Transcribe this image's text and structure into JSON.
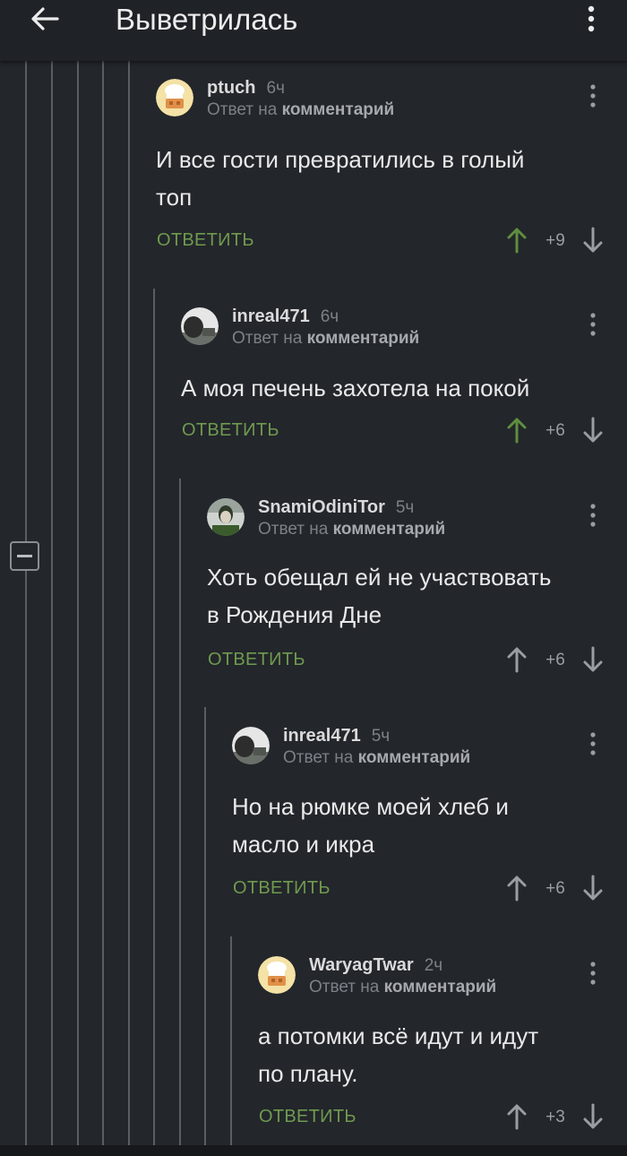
{
  "appbar": {
    "title": "Выветрилась"
  },
  "comments": [
    {
      "username": "ptuch",
      "time": "6ч",
      "reply_prefix": "Ответ на",
      "reply_link": "комментарий",
      "body": [
        "И все гости превратились в голый",
        "топ"
      ],
      "reply_label": "ОТВЕТИТЬ",
      "score": "+9",
      "upvoted": true,
      "avatar": "chef-hat-avatar"
    },
    {
      "username": "inreal471",
      "time": "6ч",
      "reply_prefix": "Ответ на",
      "reply_link": "комментарий",
      "body": [
        "А моя печень захотела на покой"
      ],
      "reply_label": "ОТВЕТИТЬ",
      "score": "+6",
      "upvoted": true,
      "avatar": "photo-avatar"
    },
    {
      "username": "SnamiOdiniTor",
      "time": "5ч",
      "reply_prefix": "Ответ на",
      "reply_link": "комментарий",
      "body": [
        "Хоть обещал ей не участвовать",
        "в Рождения Дне"
      ],
      "reply_label": "ОТВЕТИТЬ",
      "score": "+6",
      "upvoted": false,
      "avatar": "joker-avatar"
    },
    {
      "username": "inreal471",
      "time": "5ч",
      "reply_prefix": "Ответ на",
      "reply_link": "комментарий",
      "body": [
        "Но на рюмке моей хлеб и",
        "масло и икра"
      ],
      "reply_label": "ОТВЕТИТЬ",
      "score": "+6",
      "upvoted": false,
      "avatar": "photo-avatar"
    },
    {
      "username": "WaryagTwar",
      "time": "2ч",
      "reply_prefix": "Ответ на",
      "reply_link": "комментарий",
      "body": [
        "а потомки всё идут и идут",
        "по плану."
      ],
      "reply_label": "ОТВЕТИТЬ",
      "score": "+3",
      "upvoted": false,
      "avatar": "chef-hat-avatar"
    }
  ],
  "colors": {
    "background": "#23262b",
    "reply_green": "#6f9a4e",
    "upvote_active": "#5f8e3f",
    "muted": "#7d8187"
  },
  "icons": {
    "back": "arrow-left-icon",
    "menu": "more-vert-icon",
    "collapse": "minus-square-icon"
  }
}
